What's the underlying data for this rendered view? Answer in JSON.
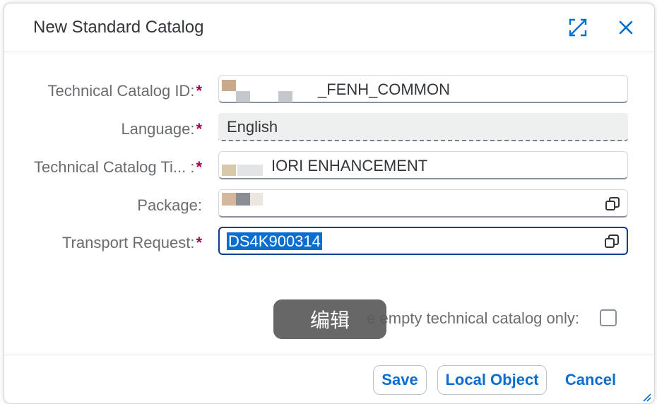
{
  "dialog": {
    "title": "New Standard Catalog",
    "expand_icon": "expand-icon",
    "close_icon": "close-icon"
  },
  "form": {
    "required_marker": "*",
    "fields": [
      {
        "label": "Technical Catalog ID:",
        "value": "_FENH_COMMON",
        "required": true
      },
      {
        "label": "Language:",
        "value": "English",
        "required": true
      },
      {
        "label": "Technical Catalog Ti... :",
        "value": "IORI ENHANCEMENT",
        "required": true
      },
      {
        "label": "Package:",
        "value": "",
        "required": false,
        "icon": "value-help-icon"
      },
      {
        "label": "Transport Request:",
        "value": "DS4K900314",
        "required": true,
        "icon": "value-help-icon"
      }
    ]
  },
  "checkbox": {
    "label": "e empty technical catalog only:",
    "checked": false
  },
  "toast": {
    "text": "编辑"
  },
  "footer": {
    "save_label": "Save",
    "local_object_label": "Local Object",
    "cancel_label": "Cancel"
  },
  "colors": {
    "accent": "#0a6ed1",
    "required": "#a0004e",
    "focus_border": "#0a3d8a"
  }
}
